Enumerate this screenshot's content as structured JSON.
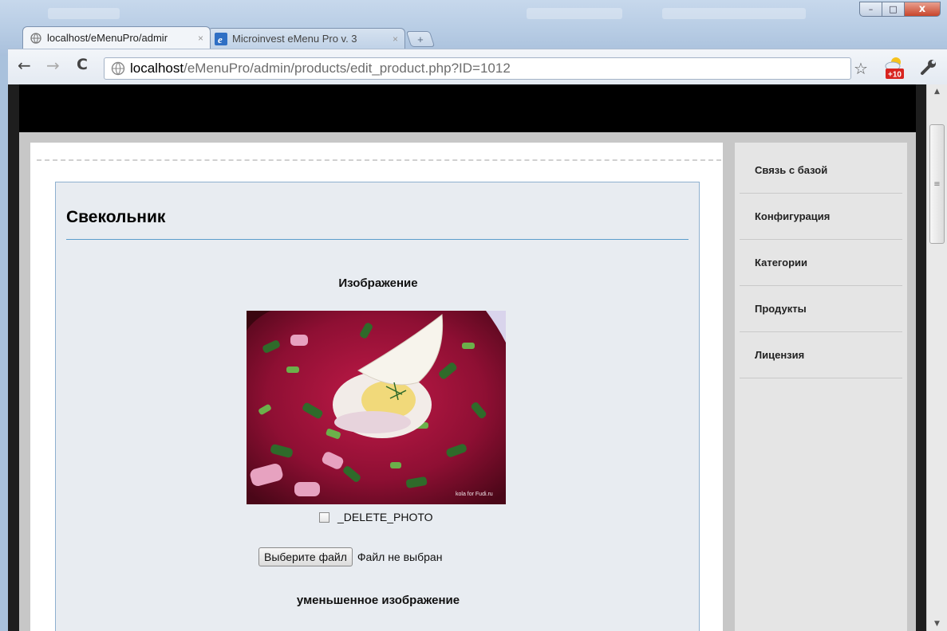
{
  "browser": {
    "tabs": [
      {
        "label": "localhost/eMenuPro/admir",
        "active": true
      },
      {
        "label": "Microinvest eMenu Pro v. 3",
        "active": false
      }
    ],
    "close_glyph": "×",
    "new_tab_glyph": "+",
    "url": {
      "host": "localhost",
      "path": "/eMenuPro/admin/products/edit_product.php?ID=1012"
    },
    "weather_badge": "+10",
    "window_buttons": {
      "minimize": "–",
      "maximize": "□",
      "close": "x"
    }
  },
  "panel": {
    "title": "Свекольник",
    "image_heading": "Изображение",
    "photo_watermark": "kola for Fudi.ru",
    "delete_photo_label": "_DELETE_PHOTO",
    "file_button": "Выберите файл",
    "file_status": "Файл не выбран",
    "thumb_heading": "уменьшенное изображение"
  },
  "sidebar": {
    "items": [
      {
        "label": "Связь с базой"
      },
      {
        "label": "Конфигурация"
      },
      {
        "label": "Категории"
      },
      {
        "label": "Продукты"
      },
      {
        "label": "Лицензия"
      }
    ]
  },
  "colors": {
    "accent_rule": "#5b9dcc",
    "panel_bg": "#e8ecf1",
    "header_bg": "#000000"
  }
}
